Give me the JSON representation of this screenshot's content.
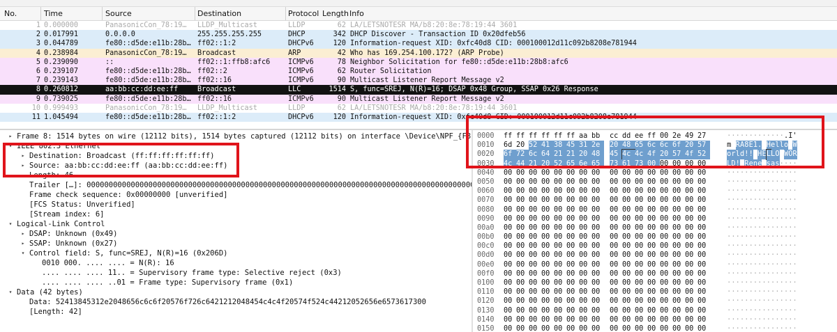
{
  "columns": {
    "no": "No.",
    "time": "Time",
    "source": "Source",
    "destination": "Destination",
    "protocol": "Protocol",
    "length": "Length",
    "info": "Info"
  },
  "packets": [
    {
      "no": "1",
      "time": "0.000000",
      "src": "PanasonicCon_78:19…",
      "dst": "LLDP_Multicast",
      "proto": "LLDP",
      "len": "62",
      "info": "LA/LETSNOTESR MA/b8:20:8e:78:19:44 3601",
      "style": "lldp"
    },
    {
      "no": "2",
      "time": "0.017991",
      "src": "0.0.0.0",
      "dst": "255.255.255.255",
      "proto": "DHCP",
      "len": "342",
      "info": "DHCP Discover - Transaction ID 0x20dfeb56",
      "style": "dhcp"
    },
    {
      "no": "3",
      "time": "0.044789",
      "src": "fe80::d5de:e11b:28b…",
      "dst": "ff02::1:2",
      "proto": "DHCPv6",
      "len": "120",
      "info": "Information-request XID: 0xfc40d8 CID: 000100012d11c092b8208e781944",
      "style": "dhcp"
    },
    {
      "no": "4",
      "time": "0.238984",
      "src": "PanasonicCon_78:19…",
      "dst": "Broadcast",
      "proto": "ARP",
      "len": "42",
      "info": "Who has 169.254.100.172? (ARP Probe)",
      "style": "arp"
    },
    {
      "no": "5",
      "time": "0.239090",
      "src": "::",
      "dst": "ff02::1:ffb8:afc6",
      "proto": "ICMPv6",
      "len": "78",
      "info": "Neighbor Solicitation for fe80::d5de:e11b:28b8:afc6",
      "style": "icmp"
    },
    {
      "no": "6",
      "time": "0.239107",
      "src": "fe80::d5de:e11b:28b…",
      "dst": "ff02::2",
      "proto": "ICMPv6",
      "len": "62",
      "info": "Router Solicitation",
      "style": "icmp"
    },
    {
      "no": "7",
      "time": "0.239143",
      "src": "fe80::d5de:e11b:28b…",
      "dst": "ff02::16",
      "proto": "ICMPv6",
      "len": "90",
      "info": "Multicast Listener Report Message v2",
      "style": "icmp"
    },
    {
      "no": "8",
      "time": "0.260812",
      "src": "aa:bb:cc:dd:ee:ff",
      "dst": "Broadcast",
      "proto": "LLC",
      "len": "1514",
      "info": "S, func=SREJ, N(R)=16; DSAP 0x48 Group, SSAP 0x26 Response",
      "style": "llc"
    },
    {
      "no": "9",
      "time": "0.739025",
      "src": "fe80::d5de:e11b:28b…",
      "dst": "ff02::16",
      "proto": "ICMPv6",
      "len": "90",
      "info": "Multicast Listener Report Message v2",
      "style": "icmp"
    },
    {
      "no": "10",
      "time": "0.999493",
      "src": "PanasonicCon_78:19…",
      "dst": "LLDP_Multicast",
      "proto": "LLDP",
      "len": "62",
      "info": "LA/LETSNOTESR MA/b8:20:8e:78:19:44 3601",
      "style": "lldp"
    },
    {
      "no": "11",
      "time": "1.045494",
      "src": "fe80::d5de:e11b:28b…",
      "dst": "ff02::1:2",
      "proto": "DHCPv6",
      "len": "120",
      "info": "Information-request XID: 0xfc40d8 CID: 000100012d11c092b8208e781944",
      "style": "dhcp"
    }
  ],
  "tree": [
    {
      "indent": 0,
      "toggle": "▸",
      "text": "Frame 8: 1514 bytes on wire (12112 bits), 1514 bytes captured (12112 bits) on interface \\Device\\NPF_{F8"
    },
    {
      "indent": 0,
      "toggle": "▾",
      "text": "IEEE 802.3 Ethernet"
    },
    {
      "indent": 1,
      "toggle": "▸",
      "text": "Destination: Broadcast (ff:ff:ff:ff:ff:ff)"
    },
    {
      "indent": 1,
      "toggle": "▸",
      "text": "Source: aa:bb:cc:dd:ee:ff (aa:bb:cc:dd:ee:ff)"
    },
    {
      "indent": 1,
      "toggle": "",
      "text": "Length: 46"
    },
    {
      "indent": 1,
      "toggle": "",
      "text": "Trailer […]: 000000000000000000000000000000000000000000000000000000000000000000000000000000000000000000000"
    },
    {
      "indent": 1,
      "toggle": "",
      "text": "Frame check sequence: 0x00000000 [unverified]"
    },
    {
      "indent": 1,
      "toggle": "",
      "text": "[FCS Status: Unverified]"
    },
    {
      "indent": 1,
      "toggle": "",
      "text": "[Stream index: 6]"
    },
    {
      "indent": 0,
      "toggle": "▾",
      "text": "Logical-Link Control"
    },
    {
      "indent": 1,
      "toggle": "▸",
      "text": "DSAP: Unknown (0x49)"
    },
    {
      "indent": 1,
      "toggle": "▸",
      "text": "SSAP: Unknown (0x27)"
    },
    {
      "indent": 1,
      "toggle": "▾",
      "text": "Control field: S, func=SREJ, N(R)=16 (0x206D)"
    },
    {
      "indent": 2,
      "toggle": "",
      "text": "0010 000. .... .... = N(R): 16"
    },
    {
      "indent": 2,
      "toggle": "",
      "text": ".... .... .... 11.. = Supervisory frame type: Selective reject (0x3)"
    },
    {
      "indent": 2,
      "toggle": "",
      "text": ".... .... .... ..01 = Frame type: Supervisory frame (0x1)"
    },
    {
      "indent": 0,
      "toggle": "▾",
      "text": "Data (42 bytes)"
    },
    {
      "indent": 1,
      "toggle": "",
      "text": "Data: 52413845312e2048656c6c6f20576f726c6421212048454c4c4f20574f524c44212052656e6573617300"
    },
    {
      "indent": 1,
      "toggle": "",
      "text": "[Length: 42]"
    }
  ],
  "hex": [
    {
      "off": "0000",
      "bytes": [
        "ff",
        "ff",
        "ff",
        "ff",
        "ff",
        "ff",
        "aa",
        "bb",
        "cc",
        "dd",
        "ee",
        "ff",
        "00",
        "2e",
        "49",
        "27"
      ],
      "ascii": [
        "·",
        "·",
        "·",
        "·",
        "·",
        "·",
        "·",
        "·",
        "·",
        "·",
        "·",
        "·",
        "·",
        ".",
        "I",
        "'"
      ],
      "hl_from": 99,
      "hl_to": -1
    },
    {
      "off": "0010",
      "bytes": [
        "6d",
        "20",
        "52",
        "41",
        "38",
        "45",
        "31",
        "2e",
        "20",
        "48",
        "65",
        "6c",
        "6c",
        "6f",
        "20",
        "57"
      ],
      "ascii": [
        "m",
        " ",
        "R",
        "A",
        "8",
        "E",
        "1",
        ".",
        " ",
        "H",
        "e",
        "l",
        "l",
        "o",
        " ",
        "W"
      ],
      "hl_from": 2,
      "hl_to": 15
    },
    {
      "off": "0020",
      "bytes": [
        "6f",
        "72",
        "6c",
        "64",
        "21",
        "21",
        "20",
        "48",
        "45",
        "4c",
        "4c",
        "4f",
        "20",
        "57",
        "4f",
        "52"
      ],
      "ascii": [
        "o",
        "r",
        "l",
        "d",
        "!",
        "!",
        " ",
        "H",
        "E",
        "L",
        "L",
        "O",
        " ",
        "W",
        "O",
        "R"
      ],
      "hl_from": 0,
      "hl_to": 15
    },
    {
      "off": "0030",
      "bytes": [
        "4c",
        "44",
        "21",
        "20",
        "52",
        "65",
        "6e",
        "65",
        "73",
        "61",
        "73",
        "00",
        "00",
        "00",
        "00",
        "00"
      ],
      "ascii": [
        "L",
        "D",
        "!",
        " ",
        "R",
        "e",
        "n",
        "e",
        " ",
        "s",
        "a",
        "s",
        "·",
        "·",
        "·",
        "·"
      ],
      "hl_from": 0,
      "hl_to": 11
    },
    {
      "off": "0040",
      "bytes": [
        "00",
        "00",
        "00",
        "00",
        "00",
        "00",
        "00",
        "00",
        "00",
        "00",
        "00",
        "00",
        "00",
        "00",
        "00",
        "00"
      ],
      "ascii": [
        "·",
        "·",
        "·",
        "·",
        "·",
        "·",
        "·",
        "·",
        "·",
        "·",
        "·",
        "·",
        "·",
        "·",
        "·",
        "·"
      ],
      "hl_from": 99,
      "hl_to": -1
    },
    {
      "off": "0050",
      "bytes": [
        "00",
        "00",
        "00",
        "00",
        "00",
        "00",
        "00",
        "00",
        "00",
        "00",
        "00",
        "00",
        "00",
        "00",
        "00",
        "00"
      ],
      "ascii": [
        "·",
        "·",
        "·",
        "·",
        "·",
        "·",
        "·",
        "·",
        "·",
        "·",
        "·",
        "·",
        "·",
        "·",
        "·",
        "·"
      ],
      "hl_from": 99,
      "hl_to": -1
    },
    {
      "off": "0060",
      "bytes": [
        "00",
        "00",
        "00",
        "00",
        "00",
        "00",
        "00",
        "00",
        "00",
        "00",
        "00",
        "00",
        "00",
        "00",
        "00",
        "00"
      ],
      "ascii": [
        "·",
        "·",
        "·",
        "·",
        "·",
        "·",
        "·",
        "·",
        "·",
        "·",
        "·",
        "·",
        "·",
        "·",
        "·",
        "·"
      ],
      "hl_from": 99,
      "hl_to": -1
    },
    {
      "off": "0070",
      "bytes": [
        "00",
        "00",
        "00",
        "00",
        "00",
        "00",
        "00",
        "00",
        "00",
        "00",
        "00",
        "00",
        "00",
        "00",
        "00",
        "00"
      ],
      "ascii": [
        "·",
        "·",
        "·",
        "·",
        "·",
        "·",
        "·",
        "·",
        "·",
        "·",
        "·",
        "·",
        "·",
        "·",
        "·",
        "·"
      ],
      "hl_from": 99,
      "hl_to": -1
    },
    {
      "off": "0080",
      "bytes": [
        "00",
        "00",
        "00",
        "00",
        "00",
        "00",
        "00",
        "00",
        "00",
        "00",
        "00",
        "00",
        "00",
        "00",
        "00",
        "00"
      ],
      "ascii": [
        "·",
        "·",
        "·",
        "·",
        "·",
        "·",
        "·",
        "·",
        "·",
        "·",
        "·",
        "·",
        "·",
        "·",
        "·",
        "·"
      ],
      "hl_from": 99,
      "hl_to": -1
    },
    {
      "off": "0090",
      "bytes": [
        "00",
        "00",
        "00",
        "00",
        "00",
        "00",
        "00",
        "00",
        "00",
        "00",
        "00",
        "00",
        "00",
        "00",
        "00",
        "00"
      ],
      "ascii": [
        "·",
        "·",
        "·",
        "·",
        "·",
        "·",
        "·",
        "·",
        "·",
        "·",
        "·",
        "·",
        "·",
        "·",
        "·",
        "·"
      ],
      "hl_from": 99,
      "hl_to": -1
    },
    {
      "off": "00a0",
      "bytes": [
        "00",
        "00",
        "00",
        "00",
        "00",
        "00",
        "00",
        "00",
        "00",
        "00",
        "00",
        "00",
        "00",
        "00",
        "00",
        "00"
      ],
      "ascii": [
        "·",
        "·",
        "·",
        "·",
        "·",
        "·",
        "·",
        "·",
        "·",
        "·",
        "·",
        "·",
        "·",
        "·",
        "·",
        "·"
      ],
      "hl_from": 99,
      "hl_to": -1
    },
    {
      "off": "00b0",
      "bytes": [
        "00",
        "00",
        "00",
        "00",
        "00",
        "00",
        "00",
        "00",
        "00",
        "00",
        "00",
        "00",
        "00",
        "00",
        "00",
        "00"
      ],
      "ascii": [
        "·",
        "·",
        "·",
        "·",
        "·",
        "·",
        "·",
        "·",
        "·",
        "·",
        "·",
        "·",
        "·",
        "·",
        "·",
        "·"
      ],
      "hl_from": 99,
      "hl_to": -1
    },
    {
      "off": "00c0",
      "bytes": [
        "00",
        "00",
        "00",
        "00",
        "00",
        "00",
        "00",
        "00",
        "00",
        "00",
        "00",
        "00",
        "00",
        "00",
        "00",
        "00"
      ],
      "ascii": [
        "·",
        "·",
        "·",
        "·",
        "·",
        "·",
        "·",
        "·",
        "·",
        "·",
        "·",
        "·",
        "·",
        "·",
        "·",
        "·"
      ],
      "hl_from": 99,
      "hl_to": -1
    },
    {
      "off": "00d0",
      "bytes": [
        "00",
        "00",
        "00",
        "00",
        "00",
        "00",
        "00",
        "00",
        "00",
        "00",
        "00",
        "00",
        "00",
        "00",
        "00",
        "00"
      ],
      "ascii": [
        "·",
        "·",
        "·",
        "·",
        "·",
        "·",
        "·",
        "·",
        "·",
        "·",
        "·",
        "·",
        "·",
        "·",
        "·",
        "·"
      ],
      "hl_from": 99,
      "hl_to": -1
    },
    {
      "off": "00e0",
      "bytes": [
        "00",
        "00",
        "00",
        "00",
        "00",
        "00",
        "00",
        "00",
        "00",
        "00",
        "00",
        "00",
        "00",
        "00",
        "00",
        "00"
      ],
      "ascii": [
        "·",
        "·",
        "·",
        "·",
        "·",
        "·",
        "·",
        "·",
        "·",
        "·",
        "·",
        "·",
        "·",
        "·",
        "·",
        "·"
      ],
      "hl_from": 99,
      "hl_to": -1
    },
    {
      "off": "00f0",
      "bytes": [
        "00",
        "00",
        "00",
        "00",
        "00",
        "00",
        "00",
        "00",
        "00",
        "00",
        "00",
        "00",
        "00",
        "00",
        "00",
        "00"
      ],
      "ascii": [
        "·",
        "·",
        "·",
        "·",
        "·",
        "·",
        "·",
        "·",
        "·",
        "·",
        "·",
        "·",
        "·",
        "·",
        "·",
        "·"
      ],
      "hl_from": 99,
      "hl_to": -1
    },
    {
      "off": "0100",
      "bytes": [
        "00",
        "00",
        "00",
        "00",
        "00",
        "00",
        "00",
        "00",
        "00",
        "00",
        "00",
        "00",
        "00",
        "00",
        "00",
        "00"
      ],
      "ascii": [
        "·",
        "·",
        "·",
        "·",
        "·",
        "·",
        "·",
        "·",
        "·",
        "·",
        "·",
        "·",
        "·",
        "·",
        "·",
        "·"
      ],
      "hl_from": 99,
      "hl_to": -1
    },
    {
      "off": "0110",
      "bytes": [
        "00",
        "00",
        "00",
        "00",
        "00",
        "00",
        "00",
        "00",
        "00",
        "00",
        "00",
        "00",
        "00",
        "00",
        "00",
        "00"
      ],
      "ascii": [
        "·",
        "·",
        "·",
        "·",
        "·",
        "·",
        "·",
        "·",
        "·",
        "·",
        "·",
        "·",
        "·",
        "·",
        "·",
        "·"
      ],
      "hl_from": 99,
      "hl_to": -1
    },
    {
      "off": "0120",
      "bytes": [
        "00",
        "00",
        "00",
        "00",
        "00",
        "00",
        "00",
        "00",
        "00",
        "00",
        "00",
        "00",
        "00",
        "00",
        "00",
        "00"
      ],
      "ascii": [
        "·",
        "·",
        "·",
        "·",
        "·",
        "·",
        "·",
        "·",
        "·",
        "·",
        "·",
        "·",
        "·",
        "·",
        "·",
        "·"
      ],
      "hl_from": 99,
      "hl_to": -1
    },
    {
      "off": "0130",
      "bytes": [
        "00",
        "00",
        "00",
        "00",
        "00",
        "00",
        "00",
        "00",
        "00",
        "00",
        "00",
        "00",
        "00",
        "00",
        "00",
        "00"
      ],
      "ascii": [
        "·",
        "·",
        "·",
        "·",
        "·",
        "·",
        "·",
        "·",
        "·",
        "·",
        "·",
        "·",
        "·",
        "·",
        "·",
        "·"
      ],
      "hl_from": 99,
      "hl_to": -1
    },
    {
      "off": "0140",
      "bytes": [
        "00",
        "00",
        "00",
        "00",
        "00",
        "00",
        "00",
        "00",
        "00",
        "00",
        "00",
        "00",
        "00",
        "00",
        "00",
        "00"
      ],
      "ascii": [
        "·",
        "·",
        "·",
        "·",
        "·",
        "·",
        "·",
        "·",
        "·",
        "·",
        "·",
        "·",
        "·",
        "·",
        "·",
        "·"
      ],
      "hl_from": 99,
      "hl_to": -1
    },
    {
      "off": "0150",
      "bytes": [
        "00",
        "00",
        "00",
        "00",
        "00",
        "00",
        "00",
        "00",
        "00",
        "00",
        "00",
        "00",
        "00",
        "00",
        "00",
        "00"
      ],
      "ascii": [
        "·",
        "·",
        "·",
        "·",
        "·",
        "·",
        "·",
        "·",
        "·",
        "·",
        "·",
        "·",
        "·",
        "·",
        "·",
        "·"
      ],
      "hl_from": 99,
      "hl_to": -1
    }
  ],
  "colors": {
    "annotation": "#e0141b",
    "selected_row": "#121212",
    "hex_highlight": "#6f9fce"
  }
}
